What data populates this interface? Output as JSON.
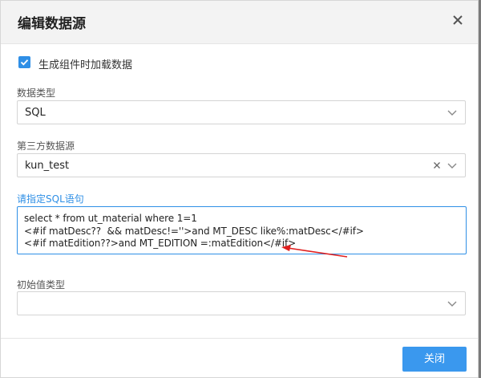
{
  "dialog": {
    "title": "编辑数据源",
    "close_icon": "close-icon",
    "load_on_generate": {
      "label": "生成组件时加载数据",
      "checked": true
    },
    "data_type": {
      "label": "数据类型",
      "value": "SQL"
    },
    "third_party_source": {
      "label": "第三方数据源",
      "value": "kun_test"
    },
    "sql": {
      "label": "请指定SQL语句",
      "lines": [
        "select * from ut_material where 1=1",
        "<#if matDesc??  && matDesc!=''>and MT_DESC like%:matDesc</#if>",
        "<#if matEdition??>and MT_EDITION =:matEdition</#if>"
      ]
    },
    "initial_value_type": {
      "label": "初始值类型",
      "value": ""
    },
    "close_button": "关闭"
  },
  "colors": {
    "accent": "#2f8fe6",
    "annotation_arrow": "#e02020",
    "header_bg": "#f3f3f3"
  }
}
